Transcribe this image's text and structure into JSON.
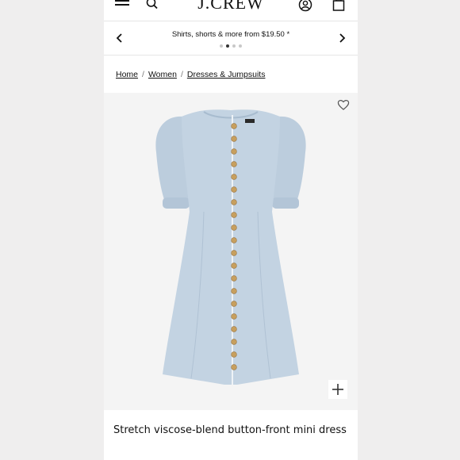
{
  "header": {
    "logo": "J.CREW",
    "icons": [
      "menu-icon",
      "search-icon",
      "account-icon",
      "bag-icon"
    ]
  },
  "promo": {
    "text": "Shirts, shorts & more from $19.50",
    "star": "*",
    "dots_total": 4,
    "active_dot": 2
  },
  "breadcrumb": {
    "items": [
      "Home",
      "Women",
      "Dresses & Jumpsuits"
    ],
    "separator": "/"
  },
  "product": {
    "title": "Stretch viscose-blend button-front mini dress",
    "image_icons": [
      "heart-icon",
      "plus-icon"
    ],
    "dress_color": "#bfd0e0",
    "button_color": "#c8a060"
  },
  "colors": {
    "page_bg": "#efeeee",
    "panel_bg": "#ffffff",
    "image_bg": "#f4f4f4",
    "text": "#111111"
  }
}
